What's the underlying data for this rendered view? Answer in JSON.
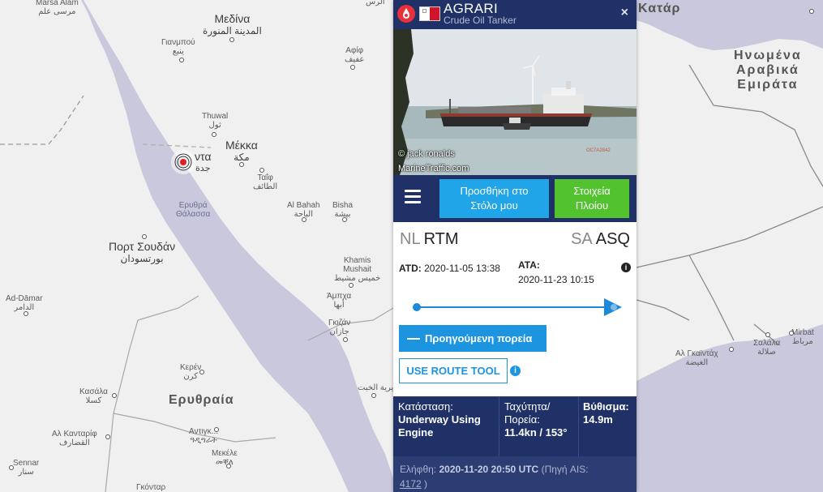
{
  "map": {
    "labels": {
      "marsa_alam": {
        "text": "Marsa Alam",
        "arabic": "مرسى علم"
      },
      "medina": {
        "text": "Μεδίνα",
        "arabic": "المدينة المنورة"
      },
      "yanbu": {
        "text": "Γιανμπού",
        "arabic": "ينبع"
      },
      "afif": {
        "text": "Αφίφ",
        "arabic": "عفيف"
      },
      "thuwal": {
        "text": "Thuwal",
        "arabic": "ثول"
      },
      "mecca": {
        "text": "Μέκκα",
        "arabic": "مكة"
      },
      "jeddah": {
        "text": "ντα",
        "arabic": "جدة"
      },
      "taif": {
        "text": "Ταΐφ",
        "arabic": "الطائف"
      },
      "red_sea": {
        "text": "Ερυθρά",
        "text2": "Θάλασσα"
      },
      "al_bahah": {
        "text": "Al Bahah",
        "arabic": "الباحة"
      },
      "bisha": {
        "text": "Bisha",
        "arabic": "بيشة"
      },
      "port_sudan": {
        "text": "Πορτ Σουδάν",
        "arabic": "بورتسودان"
      },
      "khamis": {
        "text": "Khamis",
        "text2": "Mushait",
        "arabic": "خميس مشيط"
      },
      "ad_damar": {
        "text": "Ad-Dāmar",
        "arabic": "الدامر"
      },
      "abha": {
        "text": "Άμπχα",
        "arabic": "أبها"
      },
      "jizan": {
        "text": "Γκιζάν",
        "arabic": "جازان"
      },
      "keren": {
        "text": "Κερέν",
        "arabic": "كرن"
      },
      "kassala": {
        "text": "Κασάλα",
        "arabic": "كسلا"
      },
      "eritrea": {
        "text": "Ερυθραία"
      },
      "al_qadarif": {
        "text": "Αλ Κανταρίφ",
        "arabic": "القضارف"
      },
      "adigrat": {
        "text": "Αντιγκ...",
        "arabic": "ዓዲግራት"
      },
      "mekele": {
        "text": "Μεκέλε",
        "arabic": "መቐለ"
      },
      "sennar": {
        "text": "Sennar",
        "arabic": "سنار"
      },
      "gondar": {
        "text": "Γκόνταρ"
      },
      "qatar": {
        "text": "Κατάρ"
      },
      "uae": {
        "text": "Ηνωμένα",
        "text2": "Αραβικά",
        "text3": "Εμιράτα"
      },
      "al_ghaydah": {
        "text": "Αλ Γκαϊντάχ",
        "arabic": "الغيضة"
      },
      "salalah": {
        "text": "Σαλάλα",
        "arabic": "صلالة"
      },
      "mirbat": {
        "text": "Mirbat",
        "arabic": "مرباط"
      },
      "al_khabt": {
        "arabic": "مديرية الخبت"
      },
      "top_ras": {
        "arabic": "الرس"
      }
    }
  },
  "panel": {
    "vessel_name": "AGRARI",
    "vessel_type": "Crude Oil Tanker",
    "close_label": "×",
    "photo_credit": "© jack ronalds",
    "photo_source": "MarineTraffic.com",
    "photo_id": "OC7A2842",
    "add_fleet_label_1": "Προσθήκη στο",
    "add_fleet_label_2": "Στόλο μου",
    "vessel_info_label_1": "Στοιχεία",
    "vessel_info_label_2": "Πλοίου",
    "departure": {
      "country": "NL",
      "port": "RTM"
    },
    "arrival": {
      "country": "SA",
      "port": "ASQ"
    },
    "atd_label": "ATD:",
    "atd_value": "2020-11-05 13:38",
    "ata_label": "ATA:",
    "ata_value": "2020-11-23 10:15",
    "info_icon": "i",
    "voyage_progress": 1.0,
    "prev_track_label": "Προηγούμενη πορεία",
    "route_tool_label": "USE ROUTE TOOL",
    "status_label": "Κατάσταση:",
    "status_value": "Underway Using Engine",
    "speed_label": "Ταχύτητα/ Πορεία:",
    "speed_value": "11.4kn / 153°",
    "draught_label": "Βύθισμα:",
    "draught_value": "14.9m",
    "received_label": "Ελήφθη:",
    "received_value": "2020-11-20 20:50 UTC",
    "source_label": "(Πηγή AIS:",
    "source_id": "4172",
    "source_close": ")"
  },
  "colors": {
    "header_bg": "#1f3167",
    "fleet_button": "#1fa5e8",
    "info_button": "#52c22f",
    "accent_blue": "#1c8ad9",
    "water": "#c9c8dc"
  }
}
